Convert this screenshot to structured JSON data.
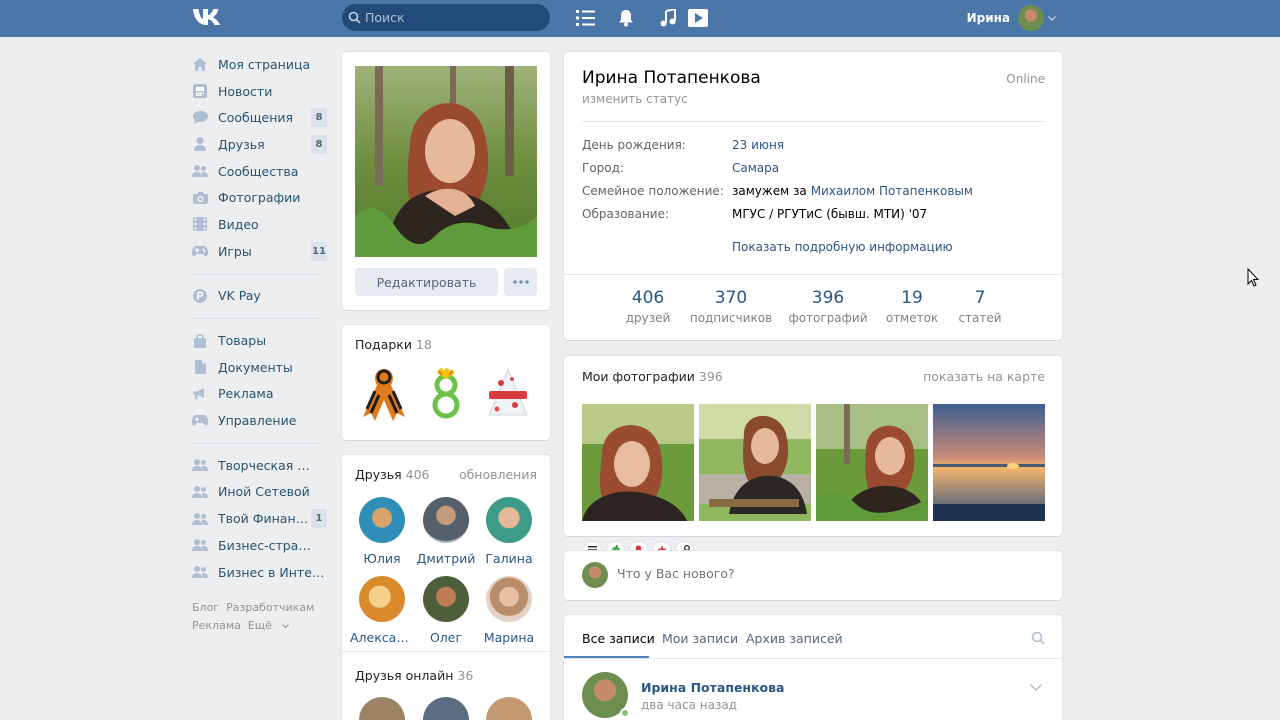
{
  "header": {
    "search_placeholder": "Поиск",
    "user_name": "Ирина"
  },
  "leftnav": {
    "items": [
      {
        "label": "Моя страница",
        "icon": "home-icon"
      },
      {
        "label": "Новости",
        "icon": "news-icon"
      },
      {
        "label": "Сообщения",
        "icon": "messages-icon",
        "badge": "8"
      },
      {
        "label": "Друзья",
        "icon": "friends-icon",
        "badge": "8"
      },
      {
        "label": "Сообщества",
        "icon": "groups-icon"
      },
      {
        "label": "Фотографии",
        "icon": "camera-icon"
      },
      {
        "label": "Видео",
        "icon": "video-icon"
      },
      {
        "label": "Игры",
        "icon": "gamepad-icon",
        "badge": "11"
      }
    ],
    "pay": {
      "label": "VK Pay",
      "icon": "vkpay-icon"
    },
    "tools": [
      {
        "label": "Товары",
        "icon": "bag-icon"
      },
      {
        "label": "Документы",
        "icon": "document-icon"
      },
      {
        "label": "Реклама",
        "icon": "megaphone-icon"
      },
      {
        "label": "Управление",
        "icon": "gamepad-icon"
      }
    ],
    "groups": [
      {
        "label": "Творческая студ..",
        "icon": "group-icon"
      },
      {
        "label": "Иной Сетевой",
        "icon": "group-icon"
      },
      {
        "label": "Твой Финансов...",
        "icon": "group-icon",
        "badge": "1"
      },
      {
        "label": "Бизнес-страница..",
        "icon": "group-icon"
      },
      {
        "label": "Бизнес в Интернете",
        "icon": "group-icon"
      }
    ],
    "footer": {
      "blog": "Блог",
      "dev": "Разработчикам",
      "ads": "Реклама",
      "more": "Ещё"
    }
  },
  "avatar_card": {
    "edit_label": "Редактировать"
  },
  "gifts": {
    "title": "Подарки",
    "count": "18"
  },
  "friends": {
    "title": "Друзья",
    "count": "406",
    "updates_link": "обновления",
    "list": [
      {
        "name": "Юлия"
      },
      {
        "name": "Дмитрий"
      },
      {
        "name": "Галина"
      },
      {
        "name": "Александ..."
      },
      {
        "name": "Олег"
      },
      {
        "name": "Марина"
      }
    ]
  },
  "friends_online": {
    "title": "Друзья онлайн",
    "count": "36"
  },
  "profile": {
    "name": "Ирина Потапенкова",
    "status": "изменить статус",
    "online": "Online",
    "info": {
      "birthday_label": "День рождения:",
      "birthday_value": "23 июня",
      "city_label": "Город:",
      "city_value": "Самара",
      "family_label": "Семейное положение:",
      "family_prefix": "замужем за",
      "family_partner": "Михаилом Потапенковым",
      "edu_label": "Образование:",
      "edu_value": "МГУС / РГУТиС (бывш. МТИ) '07"
    },
    "show_more": "Показать подробную информацию",
    "counters": [
      {
        "num": "406",
        "label": "друзей"
      },
      {
        "num": "370",
        "label": "подписчиков"
      },
      {
        "num": "396",
        "label": "фотографий"
      },
      {
        "num": "19",
        "label": "отметок"
      },
      {
        "num": "7",
        "label": "статей"
      }
    ]
  },
  "photos": {
    "title": "Мои фотографии",
    "count": "396",
    "map_link": "показать на карте"
  },
  "post_box": {
    "placeholder": "Что у Вас нового?"
  },
  "wall": {
    "tabs": {
      "all": "Все записи",
      "mine": "Мои записи",
      "archive": "Архив записей"
    },
    "post": {
      "author": "Ирина Потапенкова",
      "time": "два часа назад"
    }
  }
}
